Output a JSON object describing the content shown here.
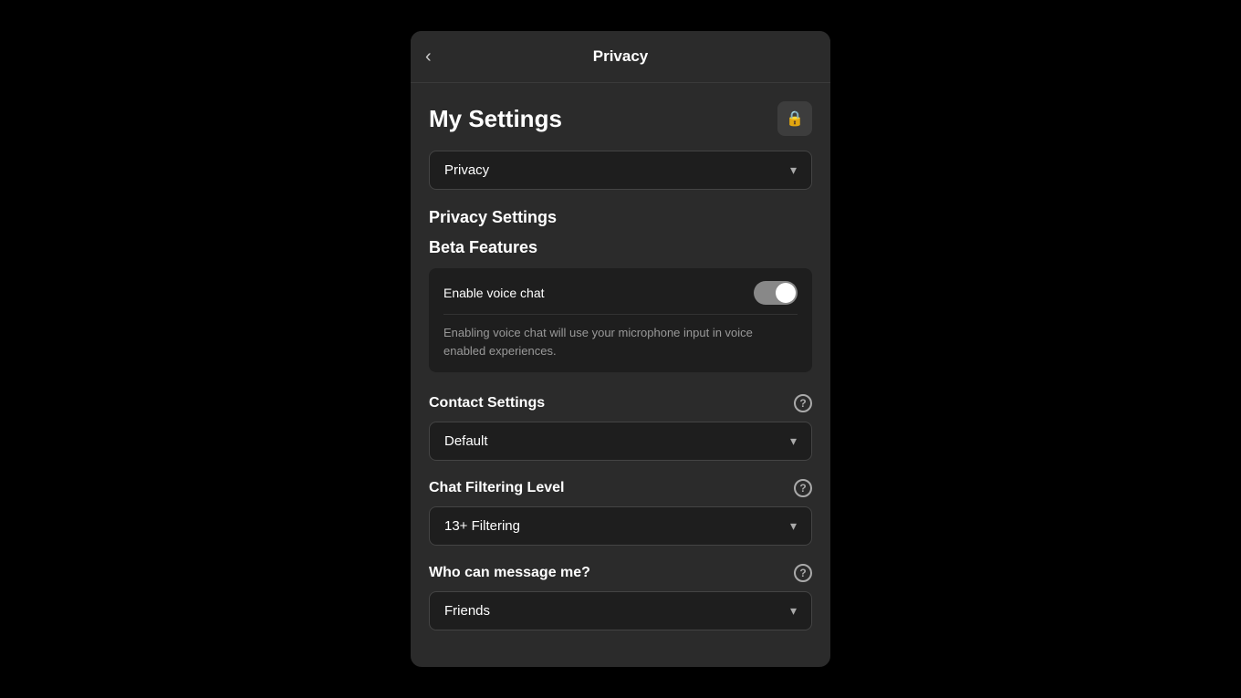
{
  "header": {
    "back_label": "‹",
    "title": "Privacy"
  },
  "my_settings": {
    "title": "My Settings",
    "lock_icon": "🔒"
  },
  "privacy_dropdown": {
    "value": "Privacy",
    "chevron": "▾"
  },
  "sections": {
    "privacy_settings": {
      "label": "Privacy Settings"
    },
    "beta_features": {
      "label": "Beta Features",
      "toggle_label": "Enable voice chat",
      "toggle_state": "on",
      "description": "Enabling voice chat will use your microphone input in voice enabled experiences."
    },
    "contact_settings": {
      "label": "Contact Settings",
      "dropdown_value": "Default",
      "chevron": "▾",
      "help": "?"
    },
    "chat_filtering": {
      "label": "Chat Filtering Level",
      "dropdown_value": "13+ Filtering",
      "chevron": "▾",
      "help": "?"
    },
    "who_can_message": {
      "label": "Who can message me?",
      "dropdown_value": "Friends",
      "chevron": "▾",
      "help": "?"
    }
  }
}
